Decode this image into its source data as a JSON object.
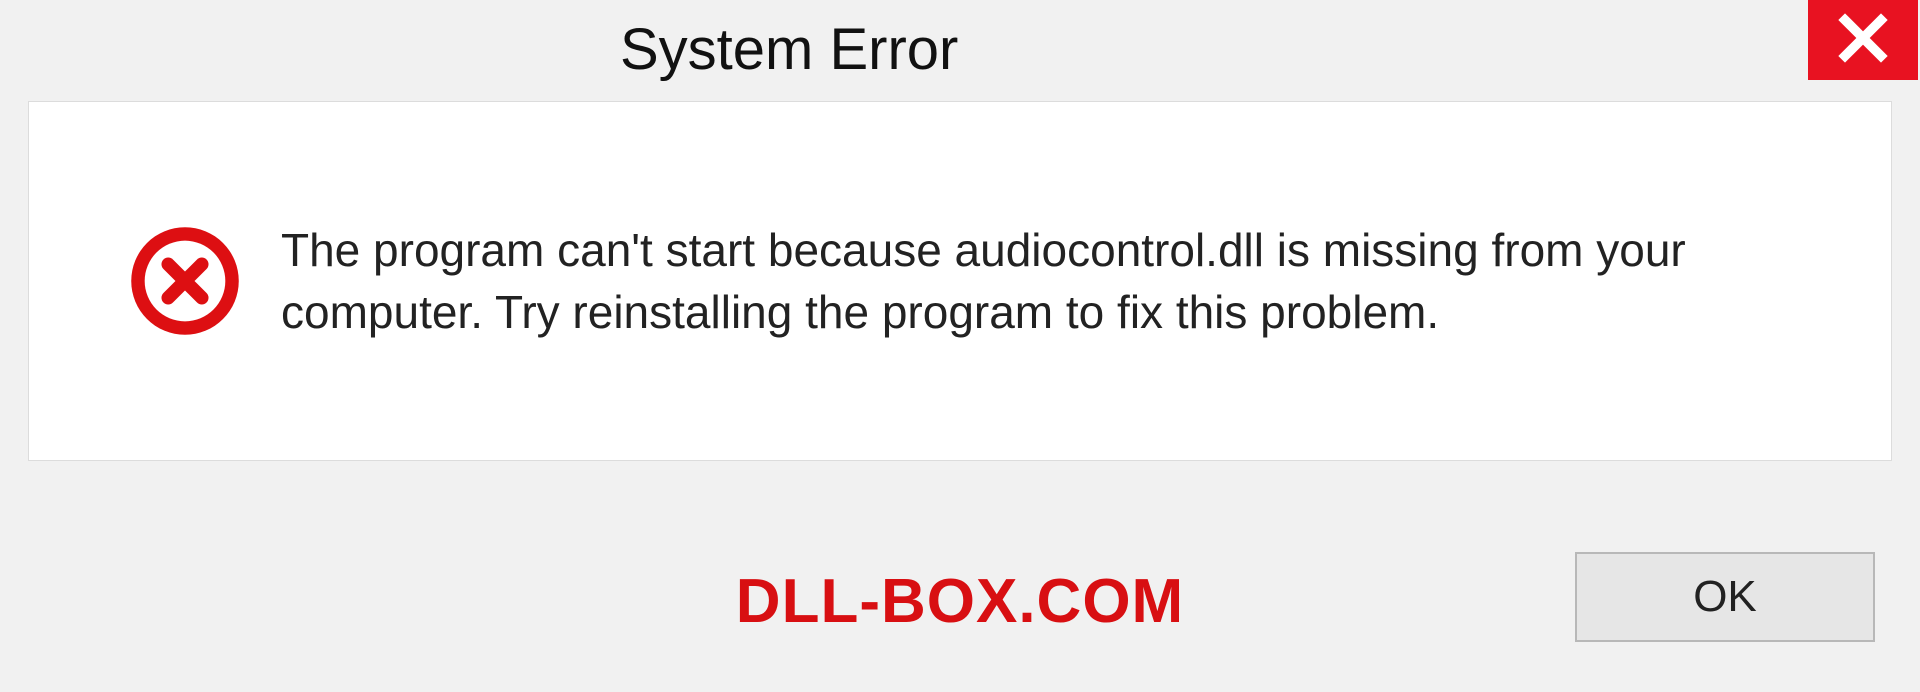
{
  "titlebar": {
    "title": "System Error"
  },
  "content": {
    "message": "The program can't start because audiocontrol.dll is missing from your computer. Try reinstalling the program to fix this problem."
  },
  "footer": {
    "watermark": "DLL-BOX.COM",
    "ok_label": "OK"
  },
  "colors": {
    "close_bg": "#e81221",
    "error_icon": "#dd0f12",
    "watermark": "#d80f12"
  }
}
